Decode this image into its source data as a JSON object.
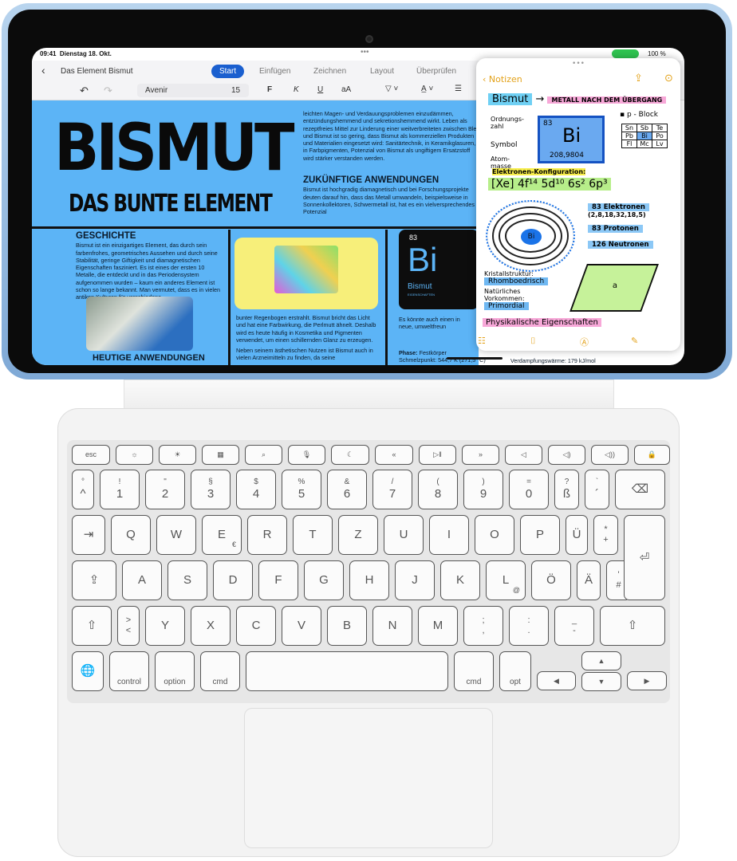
{
  "status": {
    "time": "09:41",
    "date": "Dienstag 18. Okt.",
    "battery": "100 %"
  },
  "word": {
    "doc_title": "Das Element Bismut",
    "tabs": [
      "Start",
      "Einfügen",
      "Zeichnen",
      "Layout",
      "Überprüfen"
    ],
    "active_tab": "Start",
    "font": "Avenir",
    "font_size": "15",
    "bold": "F",
    "italic": "K",
    "underline": "U",
    "case": "aA"
  },
  "doc": {
    "title": "BISMUT",
    "subtitle": "DAS BUNTE ELEMENT",
    "intro": "leichten Magen- und Verdauungsproblemen einzudämmen, entzündungshemmend und sekretionshemmend wirkt. Leben als rezeptfreies Mittel zur Linderung einer weitverbreiteten zwischen Blei und Bismut ist so gering, dass Bismut als kommerziellen Produkten und Materialien eingesetzt wird: Sanitärtechnik, in Keramikglasuren, in Farbpigmenten, Potenzial von Bismut als ungiftigem Ersatzstoff wird stärker verstanden werden.",
    "future_heading": "ZUKÜNFTIGE ANWENDUNGEN",
    "future_text": "Bismut ist hochgradig diamagnetisch und bei Forschungsprojekte deuten darauf hin, dass das Metall umwandeln, beispielsweise in Sonnenkollektoren, Schwermetall ist, hat es ein vielversprechendes Potenzial",
    "history_heading": "GESCHICHTE",
    "history_text": "Bismut ist ein einzigartiges Element, das durch sein farbenfrohes, geometrisches Aussehen und durch seine Stabilität, geringe Giftigkeit und diamagnetischen Eigenschaften fasziniert. Es ist eines der ersten 10 Metalle, die entdeckt und in das Periodensystem aufgenommen wurden – kaum ein anderes Element ist schon so lange bekannt. Man vermutet, dass es in vielen antiken Kulturen für verschiedene",
    "today_heading": "HEUTIGE ANWENDUNGEN",
    "middle_text": "bunter Regenbogen erstrahlt. Bismut bricht das Licht und hat eine Farbwirkung, die Perlmutt ähnelt. Deshalb wird es heute häufig in Kosmetika und Pigmenten verwendet, um einen schillernden Glanz zu erzeugen.",
    "middle_text2": "Neben seinem ästhetischen Nutzen ist Bismut auch in vielen Arzneimitteln zu finden, da seine",
    "card": {
      "number": "83",
      "symbol": "Bi",
      "name": "Bismut",
      "label": "EIGENSCHAFTEN"
    },
    "right_text": "Es könnte auch einen in neue, umweltfreun",
    "phase": "Phase:",
    "phase_value": "Festkörper",
    "melting": "Schmelzpunkt: 544,7 K (271,5 °C)",
    "vaporization": "Verdampfungswärme: 179 kJ/mol"
  },
  "notes": {
    "back": "Notizen",
    "title": "Bismut",
    "arrow_text": "METALL NACH DEM ÜBERGANG",
    "ordnungszahl": "Ordnungs-zahl",
    "number": "83",
    "symbol_label": "Symbol",
    "symbol": "Bi",
    "mass_label": "Atom-masse",
    "mass": "208,9804",
    "pblock": "p - Block",
    "grid": [
      "Sn",
      "Sb",
      "Te",
      "Pb",
      "Bi",
      "Po",
      "Fl",
      "Mc",
      "Lv"
    ],
    "config_label": "Elektronen-Konfiguration:",
    "config": "[Xe] 4f¹⁴ 5d¹⁰ 6s² 6p³",
    "electrons": "83 Elektronen",
    "shells": "(2,8,18,32,18,5)",
    "protons": "83 Protonen",
    "neutrons": "126 Neutronen",
    "crystal_label": "Kristallstruktur:",
    "crystal": "Rhomboedrisch",
    "occurrence_label": "Natürliches Vorkommen:",
    "occurrence": "Primordial",
    "physical": "Physikalische Eigenschaften",
    "lattice": "a"
  },
  "keyboard": {
    "fn": [
      "esc",
      "☼",
      "☀",
      "▦",
      "⌕",
      "🎙",
      "☾",
      "«",
      "▷‖",
      "»",
      "◁",
      "◁)",
      "◁))",
      "🔒"
    ],
    "row1": [
      [
        "°",
        "^"
      ],
      [
        "!",
        "1"
      ],
      [
        "\"",
        "2"
      ],
      [
        "§",
        "3"
      ],
      [
        "$",
        "4"
      ],
      [
        "%",
        "5"
      ],
      [
        "&",
        "6"
      ],
      [
        "/",
        "7"
      ],
      [
        "(",
        "8"
      ],
      [
        ")",
        "9"
      ],
      [
        "=",
        "0"
      ],
      [
        "?",
        "ß"
      ],
      [
        "`",
        "´"
      ],
      [
        "",
        "⌫"
      ]
    ],
    "row2": [
      "⇥",
      "Q",
      "W",
      "E",
      "R",
      "T",
      "Z",
      "U",
      "I",
      "O",
      "P",
      "Ü",
      "*\n+",
      "⏎"
    ],
    "row3": [
      "⇪",
      "A",
      "S",
      "D",
      "F",
      "G",
      "H",
      "J",
      "K",
      "L",
      "Ö",
      "Ä",
      "'\n#"
    ],
    "row4": [
      "⇧",
      "><",
      "Y",
      "X",
      "C",
      "V",
      "B",
      "N",
      "M",
      ";\n,",
      ":\n.",
      "_\n-",
      "⇧"
    ],
    "row5": [
      "🌐",
      "control",
      "option",
      "cmd",
      "",
      "cmd",
      "opt",
      "◀",
      "▲",
      "▼",
      "▶"
    ],
    "euro": "€",
    "at": "@"
  }
}
